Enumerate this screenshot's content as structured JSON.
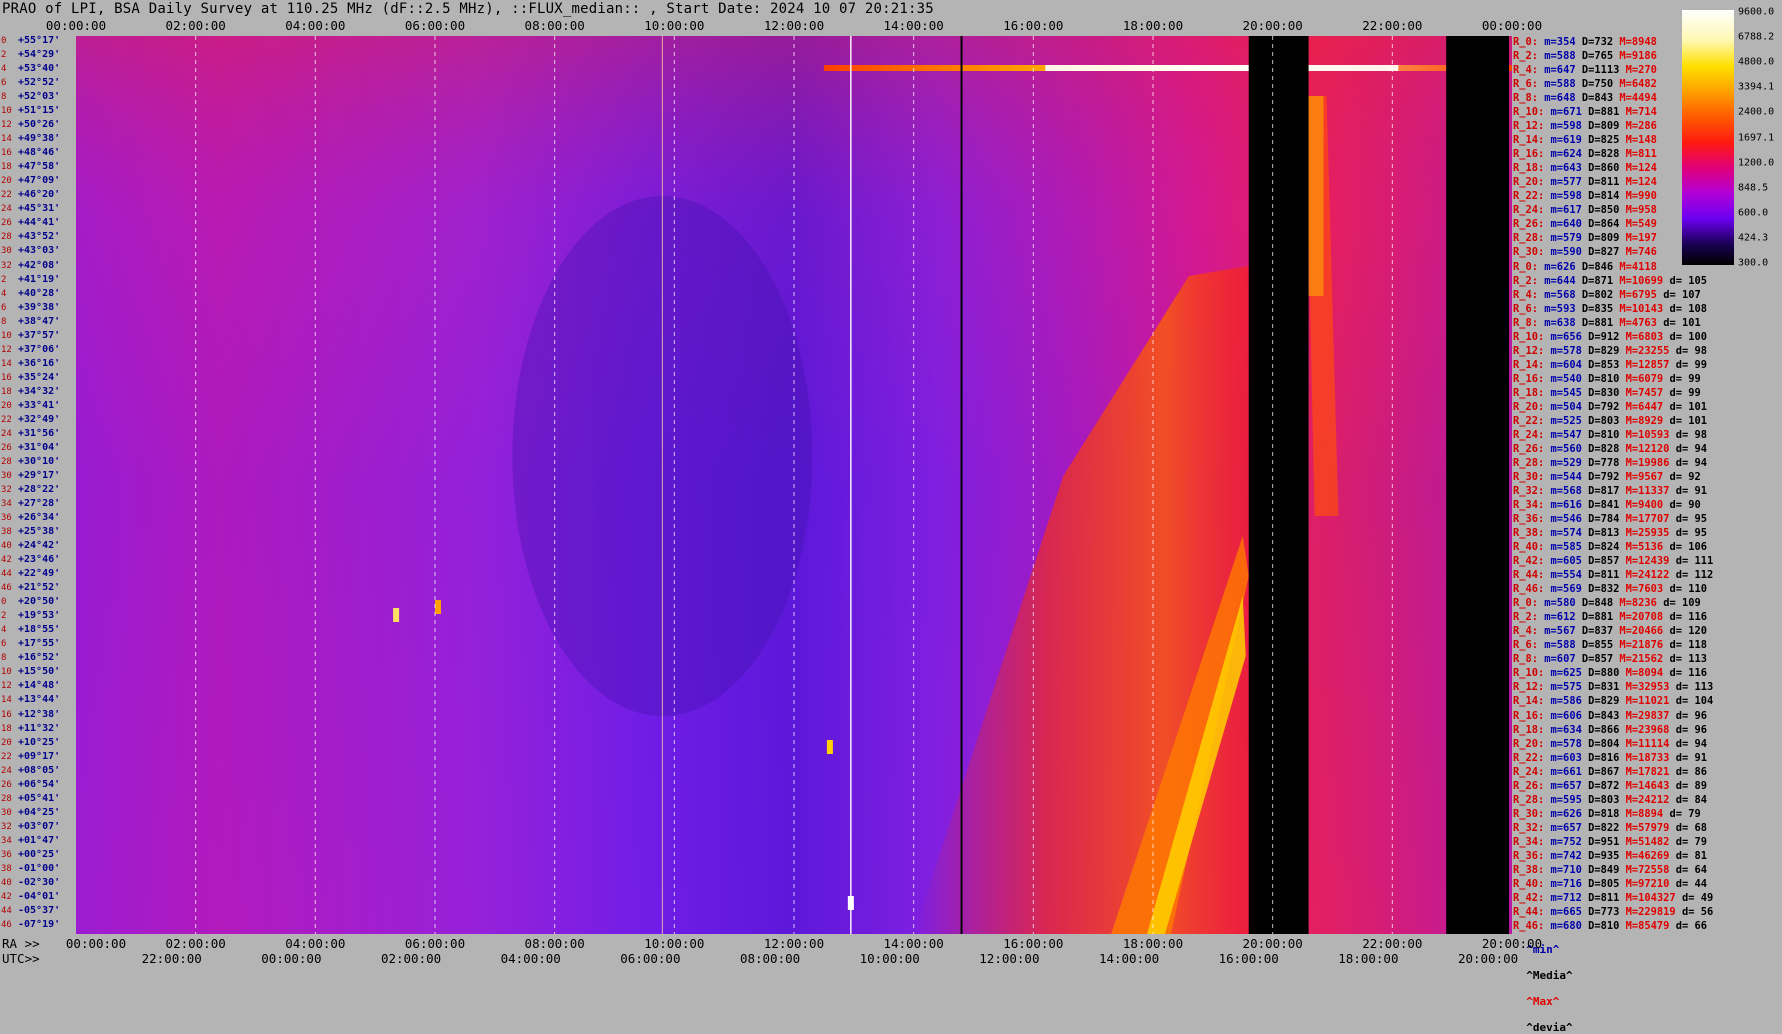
{
  "title": "PRAO of LPI, BSA Daily Survey at 110.25 MHz (dF::2.5 MHz), ::FLUX_median:: , Start Date: 2024 10 07 20:21:35",
  "top_ticks": [
    "00:00:00",
    "02:00:00",
    "04:00:00",
    "06:00:00",
    "08:00:00",
    "10:00:00",
    "12:00:00",
    "14:00:00",
    "16:00:00",
    "18:00:00",
    "20:00:00",
    "22:00:00",
    "00:00:00"
  ],
  "bottom_row1": {
    "label": "RA >>",
    "ticks": [
      "00:00:00",
      "02:00:00",
      "04:00:00",
      "06:00:00",
      "08:00:00",
      "10:00:00",
      "12:00:00",
      "14:00:00",
      "16:00:00",
      "18:00:00",
      "20:00:00",
      "22:00:00",
      "20:00:00"
    ]
  },
  "bottom_row2": {
    "label": "UTC>>",
    "ticks": [
      "22:00:00",
      "00:00:00",
      "02:00:00",
      "04:00:00",
      "06:00:00",
      "08:00:00",
      "10:00:00",
      "12:00:00",
      "14:00:00",
      "16:00:00",
      "18:00:00",
      "20:00:00"
    ]
  },
  "declinations": [
    {
      "i": "0",
      "d": "+55°17'"
    },
    {
      "i": "2",
      "d": "+54°29'"
    },
    {
      "i": "4",
      "d": "+53°40'"
    },
    {
      "i": "6",
      "d": "+52°52'"
    },
    {
      "i": "8",
      "d": "+52°03'"
    },
    {
      "i": "10",
      "d": "+51°15'"
    },
    {
      "i": "12",
      "d": "+50°26'"
    },
    {
      "i": "14",
      "d": "+49°38'"
    },
    {
      "i": "16",
      "d": "+48°46'"
    },
    {
      "i": "18",
      "d": "+47°58'"
    },
    {
      "i": "20",
      "d": "+47°09'"
    },
    {
      "i": "22",
      "d": "+46°20'"
    },
    {
      "i": "24",
      "d": "+45°31'"
    },
    {
      "i": "26",
      "d": "+44°41'"
    },
    {
      "i": "28",
      "d": "+43°52'"
    },
    {
      "i": "30",
      "d": "+43°03'"
    },
    {
      "i": "32",
      "d": "+42°08'"
    },
    {
      "i": "2",
      "d": "+41°19'"
    },
    {
      "i": "4",
      "d": "+40°28'"
    },
    {
      "i": "6",
      "d": "+39°38'"
    },
    {
      "i": "8",
      "d": "+38°47'"
    },
    {
      "i": "10",
      "d": "+37°57'"
    },
    {
      "i": "12",
      "d": "+37°06'"
    },
    {
      "i": "14",
      "d": "+36°16'"
    },
    {
      "i": "16",
      "d": "+35°24'"
    },
    {
      "i": "18",
      "d": "+34°32'"
    },
    {
      "i": "20",
      "d": "+33°41'"
    },
    {
      "i": "22",
      "d": "+32°49'"
    },
    {
      "i": "24",
      "d": "+31°56'"
    },
    {
      "i": "26",
      "d": "+31°04'"
    },
    {
      "i": "28",
      "d": "+30°10'"
    },
    {
      "i": "30",
      "d": "+29°17'"
    },
    {
      "i": "32",
      "d": "+28°22'"
    },
    {
      "i": "34",
      "d": "+27°28'"
    },
    {
      "i": "36",
      "d": "+26°34'"
    },
    {
      "i": "38",
      "d": "+25°38'"
    },
    {
      "i": "40",
      "d": "+24°42'"
    },
    {
      "i": "42",
      "d": "+23°46'"
    },
    {
      "i": "44",
      "d": "+22°49'"
    },
    {
      "i": "46",
      "d": "+21°52'"
    },
    {
      "i": "0",
      "d": "+20°50'"
    },
    {
      "i": "2",
      "d": "+19°53'"
    },
    {
      "i": "4",
      "d": "+18°55'"
    },
    {
      "i": "6",
      "d": "+17°55'"
    },
    {
      "i": "8",
      "d": "+16°52'"
    },
    {
      "i": "10",
      "d": "+15°50'"
    },
    {
      "i": "12",
      "d": "+14°48'"
    },
    {
      "i": "14",
      "d": "+13°44'"
    },
    {
      "i": "16",
      "d": "+12°38'"
    },
    {
      "i": "18",
      "d": "+11°32'"
    },
    {
      "i": "20",
      "d": "+10°25'"
    },
    {
      "i": "22",
      "d": "+09°17'"
    },
    {
      "i": "24",
      "d": "+08°05'"
    },
    {
      "i": "26",
      "d": "+06°54'"
    },
    {
      "i": "28",
      "d": "+05°41'"
    },
    {
      "i": "30",
      "d": "+04°25'"
    },
    {
      "i": "32",
      "d": "+03°07'"
    },
    {
      "i": "34",
      "d": "+01°47'"
    },
    {
      "i": "36",
      "d": "+00°25'"
    },
    {
      "i": "38",
      "d": "-01°00'"
    },
    {
      "i": "40",
      "d": "-02°30'"
    },
    {
      "i": "42",
      "d": "-04°01'"
    },
    {
      "i": "44",
      "d": "-05°37'"
    },
    {
      "i": "46",
      "d": "-07°19'"
    }
  ],
  "stats": [
    {
      "r": "R_0:",
      "m": "m=354",
      "d": "D=732",
      "x": "M=8948",
      "v": ""
    },
    {
      "r": "R_2:",
      "m": "m=588",
      "d": "D=765",
      "x": "M=9186",
      "v": ""
    },
    {
      "r": "R_4:",
      "m": "m=647",
      "d": "D=1113",
      "x": "M=270",
      "v": ""
    },
    {
      "r": "R_6:",
      "m": "m=588",
      "d": "D=750",
      "x": "M=6482",
      "v": ""
    },
    {
      "r": "R_8:",
      "m": "m=648",
      "d": "D=843",
      "x": "M=4494",
      "v": ""
    },
    {
      "r": "R_10:",
      "m": "m=671",
      "d": "D=881",
      "x": "M=714",
      "v": ""
    },
    {
      "r": "R_12:",
      "m": "m=598",
      "d": "D=809",
      "x": "M=286",
      "v": ""
    },
    {
      "r": "R_14:",
      "m": "m=619",
      "d": "D=825",
      "x": "M=148",
      "v": ""
    },
    {
      "r": "R_16:",
      "m": "m=624",
      "d": "D=828",
      "x": "M=811",
      "v": ""
    },
    {
      "r": "R_18:",
      "m": "m=643",
      "d": "D=860",
      "x": "M=124",
      "v": ""
    },
    {
      "r": "R_20:",
      "m": "m=577",
      "d": "D=811",
      "x": "M=124",
      "v": ""
    },
    {
      "r": "R_22:",
      "m": "m=598",
      "d": "D=814",
      "x": "M=990",
      "v": ""
    },
    {
      "r": "R_24:",
      "m": "m=617",
      "d": "D=850",
      "x": "M=958",
      "v": ""
    },
    {
      "r": "R_26:",
      "m": "m=640",
      "d": "D=864",
      "x": "M=549",
      "v": ""
    },
    {
      "r": "R_28:",
      "m": "m=579",
      "d": "D=809",
      "x": "M=197",
      "v": ""
    },
    {
      "r": "R_30:",
      "m": "m=590",
      "d": "D=827",
      "x": "M=746",
      "v": ""
    },
    {
      "r": "R_0:",
      "m": "m=626",
      "d": "D=846",
      "x": "M=4118",
      "v": ""
    },
    {
      "r": "R_2:",
      "m": "m=644",
      "d": "D=871",
      "x": "M=10699",
      "v": "d= 105"
    },
    {
      "r": "R_4:",
      "m": "m=568",
      "d": "D=802",
      "x": "M=6795",
      "v": "d= 107"
    },
    {
      "r": "R_6:",
      "m": "m=593",
      "d": "D=835",
      "x": "M=10143",
      "v": "d= 108"
    },
    {
      "r": "R_8:",
      "m": "m=638",
      "d": "D=881",
      "x": "M=4763",
      "v": "d= 101"
    },
    {
      "r": "R_10:",
      "m": "m=656",
      "d": "D=912",
      "x": "M=6803",
      "v": "d= 100"
    },
    {
      "r": "R_12:",
      "m": "m=578",
      "d": "D=829",
      "x": "M=23255",
      "v": "d= 98"
    },
    {
      "r": "R_14:",
      "m": "m=604",
      "d": "D=853",
      "x": "M=12857",
      "v": "d= 99"
    },
    {
      "r": "R_16:",
      "m": "m=540",
      "d": "D=810",
      "x": "M=6079",
      "v": "d= 99"
    },
    {
      "r": "R_18:",
      "m": "m=545",
      "d": "D=830",
      "x": "M=7457",
      "v": "d= 99"
    },
    {
      "r": "R_20:",
      "m": "m=504",
      "d": "D=792",
      "x": "M=6447",
      "v": "d= 101"
    },
    {
      "r": "R_22:",
      "m": "m=525",
      "d": "D=803",
      "x": "M=8929",
      "v": "d= 101"
    },
    {
      "r": "R_24:",
      "m": "m=547",
      "d": "D=810",
      "x": "M=10593",
      "v": "d= 98"
    },
    {
      "r": "R_26:",
      "m": "m=560",
      "d": "D=828",
      "x": "M=12120",
      "v": "d= 94"
    },
    {
      "r": "R_28:",
      "m": "m=529",
      "d": "D=778",
      "x": "M=19986",
      "v": "d= 94"
    },
    {
      "r": "R_30:",
      "m": "m=544",
      "d": "D=792",
      "x": "M=9567",
      "v": "d= 92"
    },
    {
      "r": "R_32:",
      "m": "m=568",
      "d": "D=817",
      "x": "M=11337",
      "v": "d= 91"
    },
    {
      "r": "R_34:",
      "m": "m=616",
      "d": "D=841",
      "x": "M=9400",
      "v": "d= 90"
    },
    {
      "r": "R_36:",
      "m": "m=546",
      "d": "D=784",
      "x": "M=17707",
      "v": "d= 95"
    },
    {
      "r": "R_38:",
      "m": "m=574",
      "d": "D=813",
      "x": "M=25935",
      "v": "d= 95"
    },
    {
      "r": "R_40:",
      "m": "m=585",
      "d": "D=824",
      "x": "M=5136",
      "v": "d= 106"
    },
    {
      "r": "R_42:",
      "m": "m=605",
      "d": "D=857",
      "x": "M=12439",
      "v": "d= 111"
    },
    {
      "r": "R_44:",
      "m": "m=554",
      "d": "D=811",
      "x": "M=24122",
      "v": "d= 112"
    },
    {
      "r": "R_46:",
      "m": "m=569",
      "d": "D=832",
      "x": "M=7603",
      "v": "d= 110"
    },
    {
      "r": "R_0:",
      "m": "m=580",
      "d": "D=848",
      "x": "M=8236",
      "v": "d= 109"
    },
    {
      "r": "R_2:",
      "m": "m=612",
      "d": "D=881",
      "x": "M=20708",
      "v": "d= 116"
    },
    {
      "r": "R_4:",
      "m": "m=567",
      "d": "D=837",
      "x": "M=20466",
      "v": "d= 120"
    },
    {
      "r": "R_6:",
      "m": "m=588",
      "d": "D=855",
      "x": "M=21876",
      "v": "d= 118"
    },
    {
      "r": "R_8:",
      "m": "m=607",
      "d": "D=857",
      "x": "M=21562",
      "v": "d= 113"
    },
    {
      "r": "R_10:",
      "m": "m=625",
      "d": "D=880",
      "x": "M=8094",
      "v": "d= 116"
    },
    {
      "r": "R_12:",
      "m": "m=575",
      "d": "D=831",
      "x": "M=32953",
      "v": "d= 113"
    },
    {
      "r": "R_14:",
      "m": "m=586",
      "d": "D=829",
      "x": "M=11021",
      "v": "d= 104"
    },
    {
      "r": "R_16:",
      "m": "m=606",
      "d": "D=843",
      "x": "M=29837",
      "v": "d= 96"
    },
    {
      "r": "R_18:",
      "m": "m=634",
      "d": "D=866",
      "x": "M=23968",
      "v": "d= 96"
    },
    {
      "r": "R_20:",
      "m": "m=578",
      "d": "D=804",
      "x": "M=11114",
      "v": "d= 94"
    },
    {
      "r": "R_22:",
      "m": "m=603",
      "d": "D=816",
      "x": "M=18733",
      "v": "d= 91"
    },
    {
      "r": "R_24:",
      "m": "m=661",
      "d": "D=867",
      "x": "M=17821",
      "v": "d= 86"
    },
    {
      "r": "R_26:",
      "m": "m=657",
      "d": "D=872",
      "x": "M=14643",
      "v": "d= 89"
    },
    {
      "r": "R_28:",
      "m": "m=595",
      "d": "D=803",
      "x": "M=24212",
      "v": "d= 84"
    },
    {
      "r": "R_30:",
      "m": "m=626",
      "d": "D=818",
      "x": "M=8894",
      "v": "d= 79"
    },
    {
      "r": "R_32:",
      "m": "m=657",
      "d": "D=822",
      "x": "M=57979",
      "v": "d= 68"
    },
    {
      "r": "R_34:",
      "m": "m=752",
      "d": "D=951",
      "x": "M=51482",
      "v": "d= 79"
    },
    {
      "r": "R_36:",
      "m": "m=742",
      "d": "D=935",
      "x": "M=46269",
      "v": "d= 81"
    },
    {
      "r": "R_38:",
      "m": "m=710",
      "d": "D=849",
      "x": "M=72558",
      "v": "d= 64"
    },
    {
      "r": "R_40:",
      "m": "m=716",
      "d": "D=805",
      "x": "M=97210",
      "v": "d= 44"
    },
    {
      "r": "R_42:",
      "m": "m=712",
      "d": "D=811",
      "x": "M=104327",
      "v": "d= 49"
    },
    {
      "r": "R_44:",
      "m": "m=665",
      "d": "D=773",
      "x": "M=229819",
      "v": "d= 56"
    },
    {
      "r": "R_46:",
      "m": "m=680",
      "d": "D=810",
      "x": "M=85479",
      "v": "d= 66"
    }
  ],
  "legend_foot": {
    "min": "^min^",
    "med": "^Media^",
    "max": "^Max^",
    "dev": "^devia^"
  },
  "colors": {
    "background": "#b4b4b4",
    "plot_base": "#7a1fe8",
    "hot": "#ff3a00",
    "sat": "#ffffff"
  },
  "chart_data": {
    "type": "heatmap",
    "title": "PRAO of LPI, BSA Daily Survey at 110.25 MHz (dF::2.5 MHz), ::FLUX_median:: , Start Date: 2024 10 07 20:21:35",
    "colorscale": {
      "ticks": [
        "9600.0",
        "6788.2",
        "4800.0",
        "3394.1",
        "2400.0",
        "1697.1",
        "1200.0",
        "848.5",
        "600.0",
        "424.3",
        "300.0"
      ],
      "values": [
        9600.0,
        6788.2,
        4800.0,
        3394.1,
        2400.0,
        1697.1,
        1200.0,
        848.5,
        600.0,
        424.3,
        300.0
      ],
      "colors": [
        "#ffffff",
        "#fff6a0",
        "#ffe000",
        "#ffb000",
        "#ff7a00",
        "#ff3000",
        "#e0006a",
        "#b000c8",
        "#7a00f0",
        "#1a0060",
        "#000000"
      ]
    },
    "x_axis_top": "RA hours 00:00:00 to 00:00:00",
    "dropouts_hours": [
      [
        19.6,
        20.6
      ],
      [
        22.9,
        23.95
      ]
    ]
  }
}
